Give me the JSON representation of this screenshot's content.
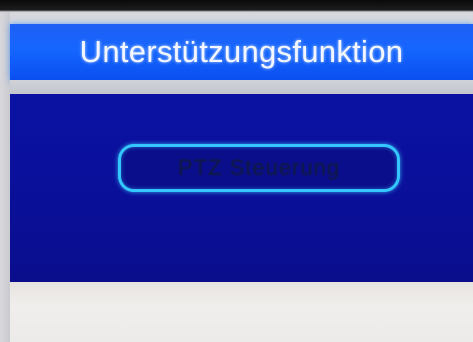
{
  "dialog": {
    "title": "Unterstützungsfunktion",
    "menu_item_label": "PTZ Steuerung"
  },
  "colors": {
    "title_bar": "#1566ff",
    "panel": "#0b12a3",
    "button_border": "#34c6ff"
  }
}
